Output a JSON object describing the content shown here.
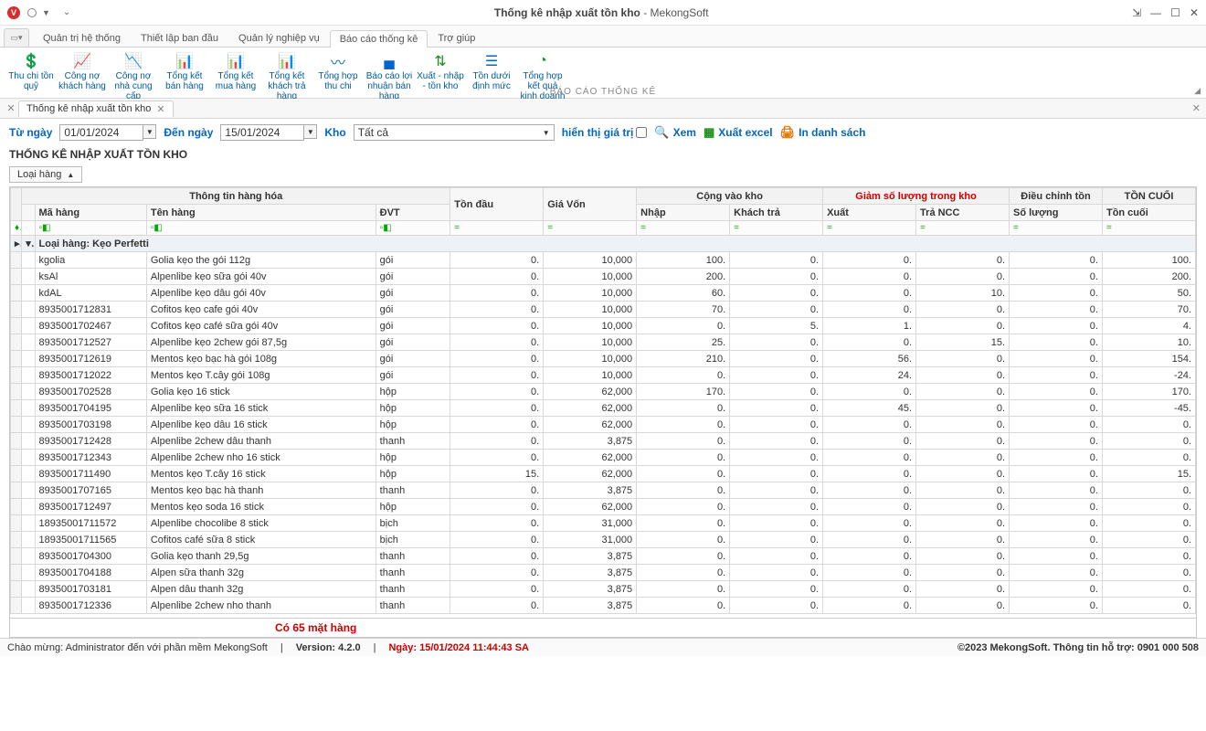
{
  "window": {
    "title_bold": "Thống kê nhập xuất tồn kho",
    "title_suffix": " - MekongSoft"
  },
  "menus": {
    "items": [
      "Quản trị hệ thống",
      "Thiết lập ban đầu",
      "Quản lý nghiệp vụ",
      "Báo cáo thống kê",
      "Trợ giúp"
    ],
    "active_index": 3
  },
  "ribbon": {
    "group_label": "BÁO CÁO THỐNG KÊ",
    "items": [
      {
        "label": "Thu chi tồn quỹ",
        "icon": "💲",
        "color": "#1a8f1a"
      },
      {
        "label": "Công nợ khách hàng",
        "icon": "📈",
        "color": "#e07000"
      },
      {
        "label": "Công nợ nhà cung cấp",
        "icon": "📉",
        "color": "#e07000"
      },
      {
        "label": "Tổng kết bán hàng",
        "icon": "📊",
        "color": "#d32f2f"
      },
      {
        "label": "Tổng kết mua hàng",
        "icon": "📊",
        "color": "#0066cc"
      },
      {
        "label": "Tổng kết khách trả hàng",
        "icon": "📊",
        "color": "#e07000"
      },
      {
        "label": "Tổng hợp thu chi",
        "icon": "〰",
        "color": "#0066cc"
      },
      {
        "label": "Báo cáo lợi nhuận bán hàng",
        "icon": "▄",
        "color": "#0066cc"
      },
      {
        "label": "Xuất - nhập - tồn kho",
        "icon": "⇅",
        "color": "#1a8f1a"
      },
      {
        "label": "Tồn dưới định mức",
        "icon": "☰",
        "color": "#0066cc"
      },
      {
        "label": "Tổng hợp kết quả kinh doanh",
        "icon": "◔",
        "color": "#1a8f1a"
      }
    ]
  },
  "doc_tab": {
    "title": "Thống kê nhập xuất tồn kho"
  },
  "filters": {
    "from_label": "Từ ngày",
    "to_label": "Đến ngày",
    "from_date": "01/01/2024",
    "to_date": "15/01/2024",
    "warehouse_label": "Kho",
    "warehouse_value": "Tất cả",
    "show_value_label": "hiển thị giá trị",
    "view_label": "Xem",
    "excel_label": "Xuất excel",
    "print_label": "In danh sách"
  },
  "report_title": "THỐNG KÊ NHẬP XUẤT TỒN KHO",
  "group_combo": "Loại hàng",
  "headers": {
    "band_info": "Thông tin hàng hóa",
    "band_in": "Cộng vào kho",
    "band_out": "Giảm số lượng trong kho",
    "band_adj": "Điều chỉnh tồn",
    "band_end": "TỒN CUỐI",
    "code": "Mã hàng",
    "name": "Tên hàng",
    "unit": "ĐVT",
    "begin": "Tồn đầu",
    "cost": "Giá Vốn",
    "in": "Nhập",
    "ret_cust": "Khách trả",
    "out": "Xuất",
    "ret_supp": "Trả NCC",
    "adj_qty": "Số lượng",
    "end": "Tồn cuối"
  },
  "group_row": "Loại hàng: Kẹo Perfetti",
  "rows": [
    {
      "code": "kgolia",
      "name": "Golia kẹo the gói 112g",
      "unit": "gói",
      "begin": "0.",
      "cost": "10,000",
      "in": "100.",
      "ret_c": "0.",
      "out": "0.",
      "ret_s": "0.",
      "adj": "0.",
      "end": "100."
    },
    {
      "code": "ksAl",
      "name": "Alpenlibe kẹo sữa gói 40v",
      "unit": "gói",
      "begin": "0.",
      "cost": "10,000",
      "in": "200.",
      "ret_c": "0.",
      "out": "0.",
      "ret_s": "0.",
      "adj": "0.",
      "end": "200."
    },
    {
      "code": "kdAL",
      "name": "Alpenlibe kẹo dâu gói 40v",
      "unit": "gói",
      "begin": "0.",
      "cost": "10,000",
      "in": "60.",
      "ret_c": "0.",
      "out": "0.",
      "ret_s": "10.",
      "adj": "0.",
      "end": "50."
    },
    {
      "code": "8935001712831",
      "name": "Cofitos kẹo cafe gói 40v",
      "unit": "gói",
      "begin": "0.",
      "cost": "10,000",
      "in": "70.",
      "ret_c": "0.",
      "out": "0.",
      "ret_s": "0.",
      "adj": "0.",
      "end": "70."
    },
    {
      "code": "8935001702467",
      "name": "Cofitos kẹo café sữa gói 40v",
      "unit": "gói",
      "begin": "0.",
      "cost": "10,000",
      "in": "0.",
      "ret_c": "5.",
      "out": "1.",
      "ret_s": "0.",
      "adj": "0.",
      "end": "4."
    },
    {
      "code": "8935001712527",
      "name": "Alpenlibe kẹo 2chew gói 87,5g",
      "unit": "gói",
      "begin": "0.",
      "cost": "10,000",
      "in": "25.",
      "ret_c": "0.",
      "out": "0.",
      "ret_s": "15.",
      "adj": "0.",
      "end": "10."
    },
    {
      "code": "8935001712619",
      "name": "Mentos kẹo bạc hà gói 108g",
      "unit": "gói",
      "begin": "0.",
      "cost": "10,000",
      "in": "210.",
      "ret_c": "0.",
      "out": "56.",
      "ret_s": "0.",
      "adj": "0.",
      "end": "154."
    },
    {
      "code": "8935001712022",
      "name": "Mentos kẹo T.cây gói 108g",
      "unit": "gói",
      "begin": "0.",
      "cost": "10,000",
      "in": "0.",
      "ret_c": "0.",
      "out": "24.",
      "ret_s": "0.",
      "adj": "0.",
      "end": "-24."
    },
    {
      "code": "8935001702528",
      "name": "Golia kẹo 16 stick",
      "unit": "hộp",
      "begin": "0.",
      "cost": "62,000",
      "in": "170.",
      "ret_c": "0.",
      "out": "0.",
      "ret_s": "0.",
      "adj": "0.",
      "end": "170."
    },
    {
      "code": "8935001704195",
      "name": "Alpenlibe kẹo sữa 16 stick",
      "unit": "hộp",
      "begin": "0.",
      "cost": "62,000",
      "in": "0.",
      "ret_c": "0.",
      "out": "45.",
      "ret_s": "0.",
      "adj": "0.",
      "end": "-45."
    },
    {
      "code": "8935001703198",
      "name": "Alpenlibe kẹo dâu 16 stick",
      "unit": "hộp",
      "begin": "0.",
      "cost": "62,000",
      "in": "0.",
      "ret_c": "0.",
      "out": "0.",
      "ret_s": "0.",
      "adj": "0.",
      "end": "0."
    },
    {
      "code": "8935001712428",
      "name": "Alpenlibe 2chew dâu thanh",
      "unit": "thanh",
      "begin": "0.",
      "cost": "3,875",
      "in": "0.",
      "ret_c": "0.",
      "out": "0.",
      "ret_s": "0.",
      "adj": "0.",
      "end": "0."
    },
    {
      "code": "8935001712343",
      "name": "Alpenlibe 2chew nho 16 stick",
      "unit": "hộp",
      "begin": "0.",
      "cost": "62,000",
      "in": "0.",
      "ret_c": "0.",
      "out": "0.",
      "ret_s": "0.",
      "adj": "0.",
      "end": "0."
    },
    {
      "code": "8935001711490",
      "name": "Mentos kẹo T.cây 16 stick",
      "unit": "hộp",
      "begin": "15.",
      "cost": "62,000",
      "in": "0.",
      "ret_c": "0.",
      "out": "0.",
      "ret_s": "0.",
      "adj": "0.",
      "end": "15."
    },
    {
      "code": "8935001707165",
      "name": "Mentos kẹo bạc hà thanh",
      "unit": "thanh",
      "begin": "0.",
      "cost": "3,875",
      "in": "0.",
      "ret_c": "0.",
      "out": "0.",
      "ret_s": "0.",
      "adj": "0.",
      "end": "0."
    },
    {
      "code": "8935001712497",
      "name": "Mentos kẹo soda 16 stick",
      "unit": "hộp",
      "begin": "0.",
      "cost": "62,000",
      "in": "0.",
      "ret_c": "0.",
      "out": "0.",
      "ret_s": "0.",
      "adj": "0.",
      "end": "0."
    },
    {
      "code": "18935001711572",
      "name": "Alpenlibe chocolibe 8 stick",
      "unit": "bịch",
      "begin": "0.",
      "cost": "31,000",
      "in": "0.",
      "ret_c": "0.",
      "out": "0.",
      "ret_s": "0.",
      "adj": "0.",
      "end": "0."
    },
    {
      "code": "18935001711565",
      "name": "Cofitos café sữa 8 stick",
      "unit": "bịch",
      "begin": "0.",
      "cost": "31,000",
      "in": "0.",
      "ret_c": "0.",
      "out": "0.",
      "ret_s": "0.",
      "adj": "0.",
      "end": "0."
    },
    {
      "code": "8935001704300",
      "name": "Golia kẹo thanh 29,5g",
      "unit": "thanh",
      "begin": "0.",
      "cost": "3,875",
      "in": "0.",
      "ret_c": "0.",
      "out": "0.",
      "ret_s": "0.",
      "adj": "0.",
      "end": "0."
    },
    {
      "code": "8935001704188",
      "name": "Alpen sữa thanh 32g",
      "unit": "thanh",
      "begin": "0.",
      "cost": "3,875",
      "in": "0.",
      "ret_c": "0.",
      "out": "0.",
      "ret_s": "0.",
      "adj": "0.",
      "end": "0."
    },
    {
      "code": "8935001703181",
      "name": "Alpen dâu thanh 32g",
      "unit": "thanh",
      "begin": "0.",
      "cost": "3,875",
      "in": "0.",
      "ret_c": "0.",
      "out": "0.",
      "ret_s": "0.",
      "adj": "0.",
      "end": "0."
    },
    {
      "code": "8935001712336",
      "name": "Alpenlibe 2chew nho thanh",
      "unit": "thanh",
      "begin": "0.",
      "cost": "3,875",
      "in": "0.",
      "ret_c": "0.",
      "out": "0.",
      "ret_s": "0.",
      "adj": "0.",
      "end": "0."
    }
  ],
  "summary": "Có 65 mặt hàng",
  "status": {
    "welcome": "Chào mừng: Administrator đến với phần mềm MekongSoft",
    "version_label": "Version: 4.2.0",
    "datetime": "Ngày: 15/01/2024 11:44:43 SA",
    "right": "©2023 MekongSoft. Thông tin hỗ trợ: 0901 000 508"
  }
}
